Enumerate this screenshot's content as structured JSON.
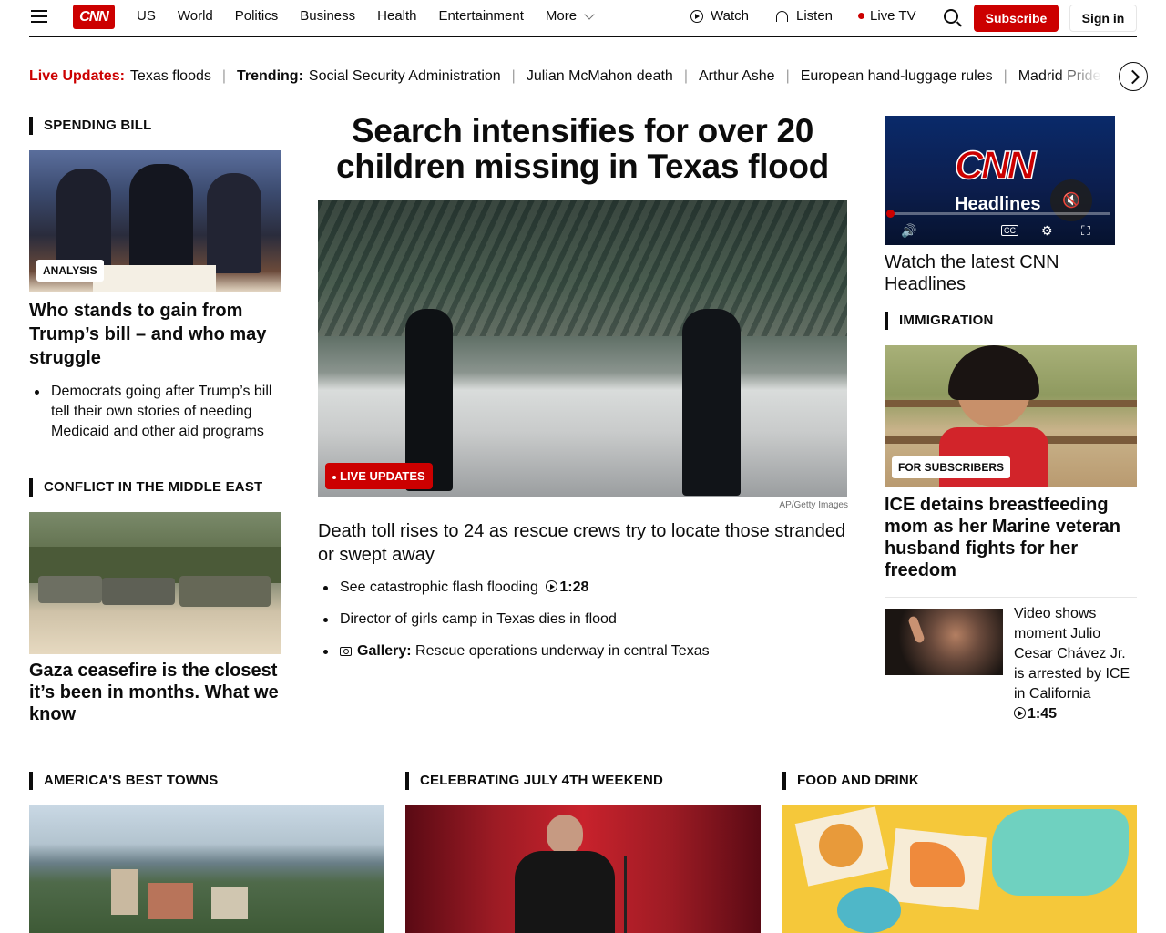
{
  "header": {
    "logo": "CNN",
    "nav": [
      "US",
      "World",
      "Politics",
      "Business",
      "Health",
      "Entertainment",
      "More"
    ],
    "watch": "Watch",
    "listen": "Listen",
    "live_tv": "Live TV",
    "subscribe": "Subscribe",
    "sign_in": "Sign in"
  },
  "ticker": {
    "live_label": "Live Updates:",
    "live_link": "Texas floods",
    "trending_label": "Trending:",
    "items": [
      "Social Security Administration",
      "Julian McMahon death",
      "Arthur Ashe",
      "European hand-luggage rules",
      "Madrid Pride"
    ]
  },
  "left": {
    "section1": "Spending bill",
    "badge1": "ANALYSIS",
    "headline1": "Who stands to gain from Trump’s bill – and who may struggle",
    "bullet1": "Democrats going after Trump’s bill tell their own stories of needing Medicaid and other aid programs",
    "section2": "Conflict in the Middle East",
    "headline2": "Gaza ceasefire is the closest it’s been in months. What we know"
  },
  "main": {
    "title": "Search intensifies for over 20 children missing in Texas flood",
    "live_tag": "LIVE UPDATES",
    "credit": "AP/Getty Images",
    "subhead": "Death toll rises to 24 as rescue crews try to locate those stranded or swept away",
    "links": [
      {
        "text": "See catastrophic flash flooding",
        "duration": "1:28"
      },
      {
        "text": "Director of girls camp in Texas dies in flood"
      },
      {
        "label": "Gallery:",
        "text": "Rescue operations underway in central Texas"
      }
    ]
  },
  "right": {
    "player_brand": "CNN",
    "player_subtitle": "Headlines",
    "player_caption": "Watch the latest CNN Headlines",
    "section": "Immigration",
    "badge": "FOR SUBSCRIBERS",
    "headline": "ICE detains breastfeeding mom as her Marine veteran husband fights for her freedom",
    "side_text": "Video shows moment Julio Cesar Chávez Jr. is arrested by ICE in California",
    "side_duration": "1:45"
  },
  "bottom": {
    "sections": [
      "America's Best Towns",
      "Celebrating July 4th weekend",
      "Food and drink"
    ]
  }
}
